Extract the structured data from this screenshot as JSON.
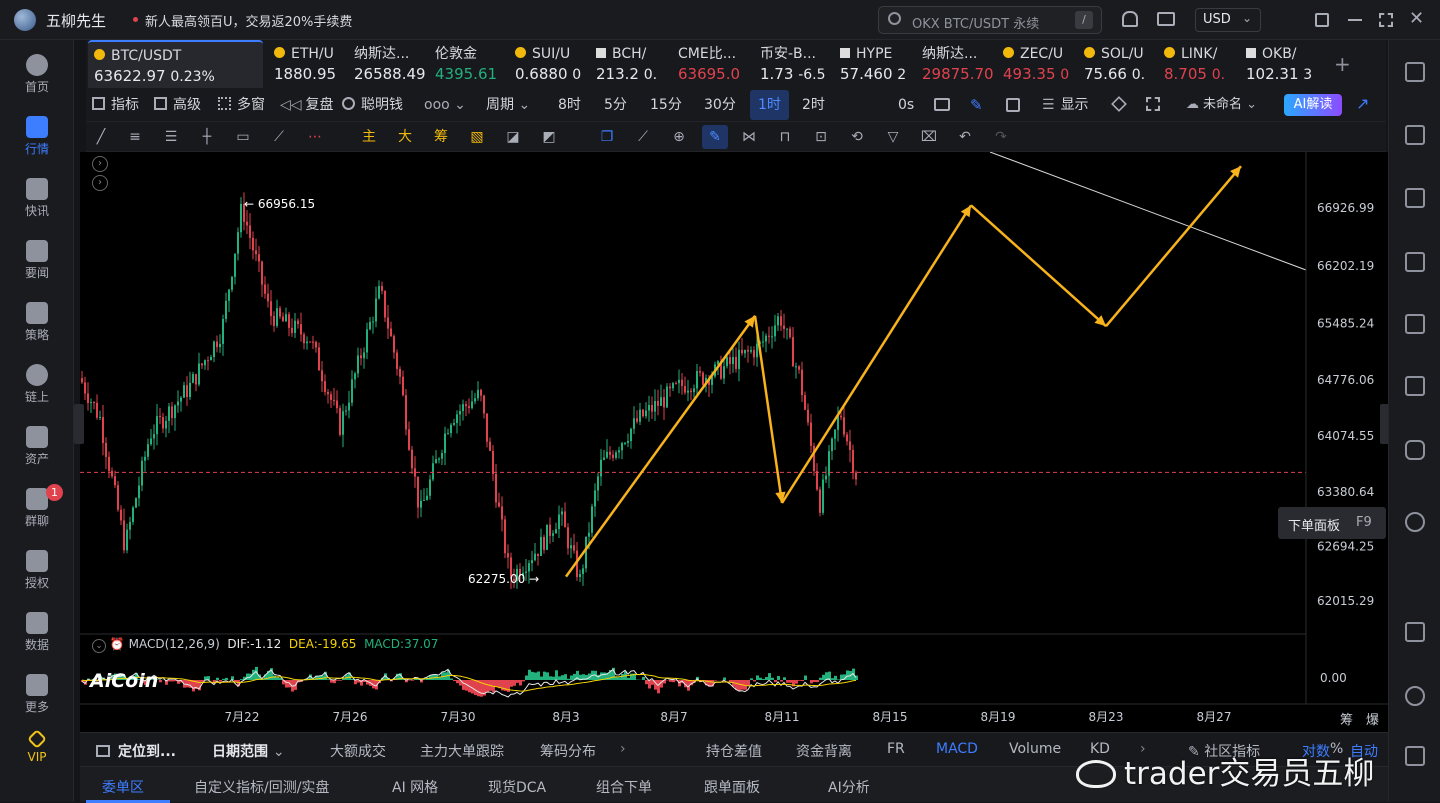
{
  "titlebar": {
    "app_name": "五柳先生",
    "promo": "新人最高领百U，交易返20%手续费",
    "search_placeholder": "OKX BTC/USDT 永续",
    "search_hotkey": "/",
    "currency": "USD"
  },
  "left_sidebar": [
    {
      "label": "首页",
      "icon": "home-icon"
    },
    {
      "label": "行情",
      "icon": "chart-bars-icon",
      "active": true
    },
    {
      "label": "快讯",
      "icon": "news-icon"
    },
    {
      "label": "要闻",
      "icon": "headline-icon"
    },
    {
      "label": "策略",
      "icon": "robot-icon"
    },
    {
      "label": "链上",
      "icon": "chain-icon"
    },
    {
      "label": "资产",
      "icon": "wallet-icon"
    },
    {
      "label": "群聊",
      "icon": "chat-icon",
      "badge": "1"
    },
    {
      "label": "授权",
      "icon": "auth-icon"
    },
    {
      "label": "数据",
      "icon": "data-icon"
    },
    {
      "label": "更多",
      "icon": "more-icon"
    },
    {
      "label": "VIP",
      "icon": "vip-icon"
    }
  ],
  "tickers": [
    {
      "name": "BTC/USDT",
      "price": "63622.97",
      "change": "0.23%",
      "trend": "active"
    },
    {
      "name": "ETH/U",
      "price": "1880.95",
      "trend": "neutral"
    },
    {
      "name": "纳斯达...",
      "price": "26588.49",
      "trend": "neutral"
    },
    {
      "name": "伦敦金",
      "price": "4395.61",
      "trend": "up"
    },
    {
      "name": "SUI/U",
      "price": "0.6880",
      "change": "0",
      "trend": "neutral"
    },
    {
      "name": "BCH/",
      "price": "213.2",
      "change": "0.",
      "trend": "neutral"
    },
    {
      "name": "CME比...",
      "price": "63695.0",
      "trend": "down"
    },
    {
      "name": "币安-B...",
      "price": "1.73",
      "change": "-6.5",
      "trend": "neutral"
    },
    {
      "name": "HYPE",
      "price": "57.460",
      "change": "2",
      "trend": "neutral"
    },
    {
      "name": "纳斯达...",
      "price": "29875.70",
      "trend": "down"
    },
    {
      "name": "ZEC/U",
      "price": "493.35",
      "change": "0",
      "trend": "down"
    },
    {
      "name": "SOL/U",
      "price": "75.66",
      "change": "0.",
      "trend": "neutral"
    },
    {
      "name": "LINK/",
      "price": "8.705",
      "change": "0.",
      "trend": "down"
    },
    {
      "name": "OKB/",
      "price": "102.31",
      "change": "3",
      "trend": "neutral"
    }
  ],
  "toolbar1": {
    "indicator": "指标",
    "advanced": "高级",
    "multiwin": "多窗",
    "replay": "复盘",
    "smart": "聪明钱",
    "period_label": "周期",
    "periods": [
      "8时",
      "5分",
      "15分",
      "30分",
      "1时",
      "2时"
    ],
    "active_period": "1时",
    "countdown": "0s",
    "display": "显示",
    "unnamed": "未命名",
    "ai_button": "AI解读"
  },
  "toolbar2": {
    "main": "主",
    "big": "大",
    "chip": "筹"
  },
  "chart_data": {
    "type": "candlestick",
    "symbol": "BTC/USDT",
    "interval": "1时",
    "y_ticks": [
      66926.99,
      66202.19,
      65485.24,
      64776.06,
      64074.55,
      63380.64,
      62694.25,
      62015.29
    ],
    "x_ticks": [
      "7月22",
      "7月26",
      "7月30",
      "8月3",
      "8月7",
      "8月11",
      "8月15",
      "8月19",
      "8月23",
      "8月27"
    ],
    "high_label": "← 66956.15",
    "low_label": "62275.00 →",
    "last_price_line": 63622.97,
    "path_annotation": [
      {
        "date": "8月3",
        "price": 62320
      },
      {
        "date": "8月10",
        "price": 65580
      },
      {
        "date": "8月11",
        "price": 63240
      },
      {
        "date": "8月18",
        "price": 66960
      },
      {
        "date": "8月23",
        "price": 65450
      },
      {
        "date": "8月28",
        "price": 67450
      }
    ],
    "macd": {
      "label": "MACD(12,26,9)",
      "dif": "DIF:-1.12",
      "dea": "DEA:-19.65",
      "macd": "MACD:37.07",
      "zero_label": "0.00"
    },
    "logo": "AiCoin",
    "axis_right_extra": [
      "筹",
      "爆"
    ],
    "order_panel": "下单面板",
    "order_panel_key": "F9"
  },
  "bottom_tabs1": {
    "locate": "定位到...",
    "date_range": "日期范围",
    "items": [
      "大额成交",
      "主力大单跟踪",
      "筹码分布",
      "持仓差值",
      "资金背离",
      "FR",
      "MACD",
      "Volume",
      "KD"
    ],
    "active": "MACD",
    "community": "社区指标",
    "log": "对数",
    "pct": "%",
    "auto": "自动"
  },
  "bottom_tabs2": {
    "items": [
      "委单区",
      "自定义指标/回测/实盘",
      "AI 网格",
      "现货DCA",
      "组合下单",
      "跟单面板",
      "AI分析"
    ],
    "active": "委单区"
  },
  "watermark": "trader交易员五柳",
  "colors": {
    "accent": "#3d7dff",
    "up": "#22b07d",
    "down": "#e0424e",
    "annotation": "#f7b21c",
    "macd_dea": "#f5d400"
  }
}
